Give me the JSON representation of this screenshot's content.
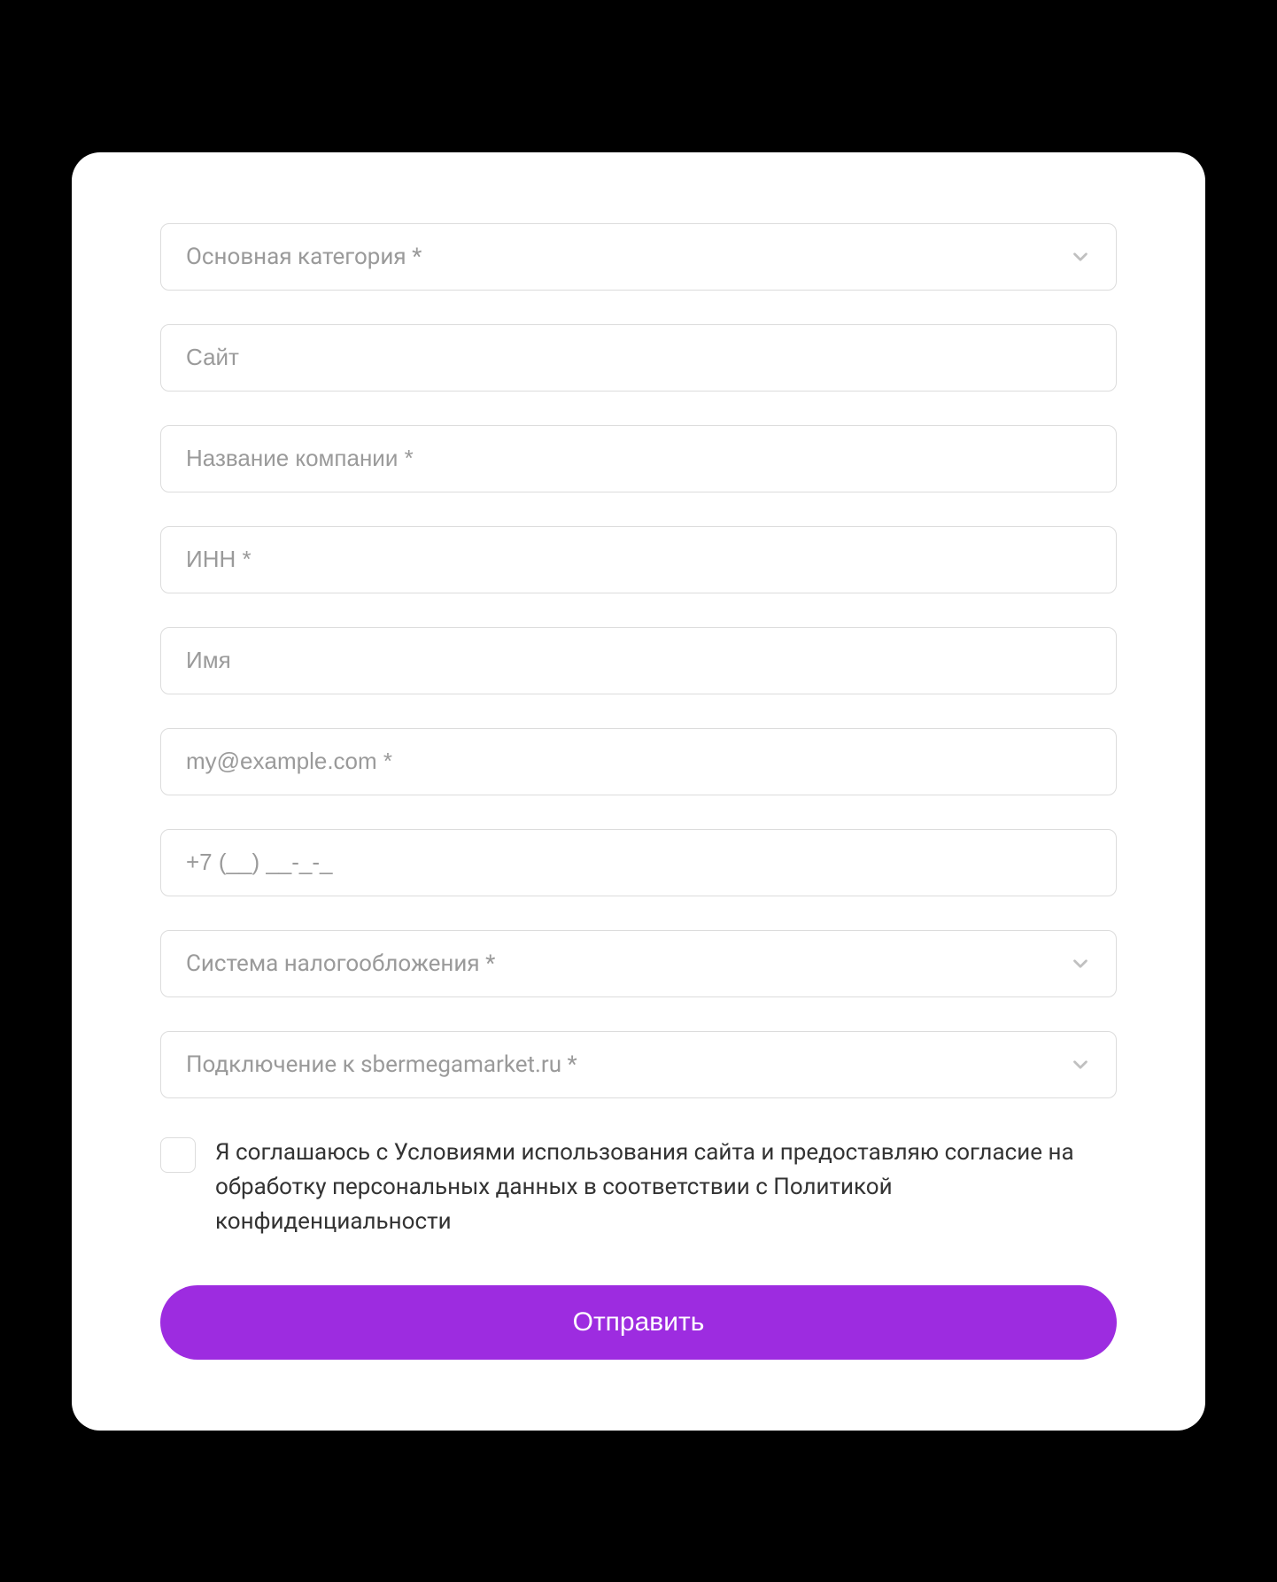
{
  "form": {
    "fields": {
      "category": {
        "placeholder": "Основная категория *"
      },
      "website": {
        "placeholder": "Сайт"
      },
      "company": {
        "placeholder": "Название компании *"
      },
      "inn": {
        "placeholder": "ИНН *"
      },
      "name": {
        "placeholder": "Имя"
      },
      "email": {
        "placeholder": "my@example.com *"
      },
      "phone": {
        "placeholder": "+7 (__) __-_-_"
      },
      "tax_system": {
        "placeholder": "Система налогообложения *"
      },
      "connection": {
        "placeholder": "Подключение к sbermegamarket.ru *"
      }
    },
    "consent": {
      "text": "Я соглашаюсь с Условиями использования сайта и предоставляю согласие на обработку персональных данных в соответствии с Политикой конфиденциальности"
    },
    "submit": {
      "label": "Отправить"
    }
  },
  "colors": {
    "primary": "#9d2ce0",
    "border": "#dcdcdc",
    "placeholder": "#9a9a9a",
    "text": "#333333"
  }
}
